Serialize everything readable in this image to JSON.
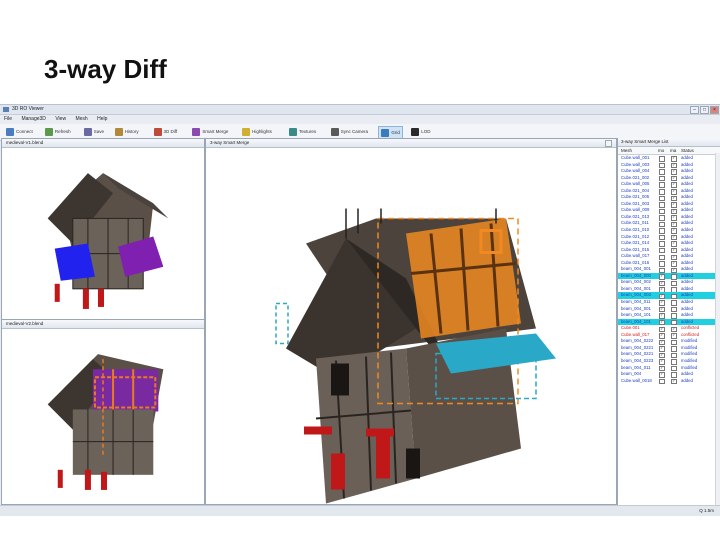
{
  "slide": {
    "title": "3-way Diff"
  },
  "window": {
    "title": "3D RO Viewer"
  },
  "menu": [
    "File",
    "Manage3D",
    "View",
    "Mesh",
    "Help"
  ],
  "toolbar": {
    "buttons": [
      {
        "label": "Connect",
        "icon": "plug-icon",
        "color": "#4a7cc0"
      },
      {
        "label": "Refresh",
        "icon": "refresh-icon",
        "color": "#5a9a4a"
      },
      {
        "label": "Save",
        "icon": "save-icon",
        "color": "#6a6aa0"
      },
      {
        "label": "History",
        "icon": "clock-icon",
        "color": "#b08a3a"
      },
      {
        "label": "3D Diff",
        "icon": "diff-icon",
        "color": "#c04a3a"
      },
      {
        "label": "Smart Merge",
        "icon": "merge-icon",
        "color": "#8a4ab0"
      },
      {
        "label": "Highlights",
        "icon": "highlight-icon",
        "color": "#d0b030"
      },
      {
        "label": "Textures",
        "icon": "texture-icon",
        "color": "#3a8a8a"
      },
      {
        "label": "Sync Camera",
        "icon": "camera-icon",
        "color": "#5a5a5a"
      },
      {
        "label": "Grid",
        "icon": "grid-icon",
        "color": "#3a7ac0"
      },
      {
        "label": "LOD",
        "icon": "lod-icon",
        "color": "#2a2a2a"
      }
    ],
    "active_index": 9
  },
  "panes": {
    "left_top": {
      "title": "medieval-V1.blend"
    },
    "left_bottom": {
      "title": "medieval-V2.blend"
    },
    "merge": {
      "title": "3-way Smart Merge"
    }
  },
  "list": {
    "title": "3-way Smart Merge List",
    "headers": {
      "mesh": "Mesh",
      "mine": "mo",
      "master": "ma",
      "status": "Status"
    },
    "rows": [
      {
        "mesh": "Cube.wall_001",
        "status": "added",
        "color": "#2040c0",
        "hl": false,
        "mine": false,
        "master": true
      },
      {
        "mesh": "Cube.wall_003",
        "status": "added",
        "color": "#2040c0",
        "hl": false,
        "mine": false,
        "master": true
      },
      {
        "mesh": "Cube.wall_004",
        "status": "added",
        "color": "#2040c0",
        "hl": false,
        "mine": false,
        "master": true
      },
      {
        "mesh": "Cube.021_002",
        "status": "added",
        "color": "#2040c0",
        "hl": false,
        "mine": false,
        "master": true
      },
      {
        "mesh": "Cube.wall_005",
        "status": "added",
        "color": "#2040c0",
        "hl": false,
        "mine": false,
        "master": true
      },
      {
        "mesh": "Cube.021_004",
        "status": "added",
        "color": "#2040c0",
        "hl": false,
        "mine": false,
        "master": true
      },
      {
        "mesh": "Cube.021_005",
        "status": "added",
        "color": "#2040c0",
        "hl": false,
        "mine": false,
        "master": true
      },
      {
        "mesh": "Cube.021_003",
        "status": "added",
        "color": "#2040c0",
        "hl": false,
        "mine": false,
        "master": true
      },
      {
        "mesh": "Cube.wall_009",
        "status": "added",
        "color": "#2040c0",
        "hl": false,
        "mine": false,
        "master": true
      },
      {
        "mesh": "Cube.021_013",
        "status": "added",
        "color": "#2040c0",
        "hl": false,
        "mine": false,
        "master": true
      },
      {
        "mesh": "Cube.021_011",
        "status": "added",
        "color": "#2040c0",
        "hl": false,
        "mine": false,
        "master": true
      },
      {
        "mesh": "Cube.021_010",
        "status": "added",
        "color": "#2040c0",
        "hl": false,
        "mine": false,
        "master": true
      },
      {
        "mesh": "Cube.021_012",
        "status": "added",
        "color": "#2040c0",
        "hl": false,
        "mine": false,
        "master": true
      },
      {
        "mesh": "Cube.021_014",
        "status": "added",
        "color": "#2040c0",
        "hl": false,
        "mine": false,
        "master": true
      },
      {
        "mesh": "Cube.021_015",
        "status": "added",
        "color": "#2040c0",
        "hl": false,
        "mine": false,
        "master": true
      },
      {
        "mesh": "Cube.wall_017",
        "status": "added",
        "color": "#2040c0",
        "hl": false,
        "mine": false,
        "master": true
      },
      {
        "mesh": "Cube.021_016",
        "status": "added",
        "color": "#2040c0",
        "hl": false,
        "mine": false,
        "master": true
      },
      {
        "mesh": "beam_004_001",
        "status": "added",
        "color": "#2040c0",
        "hl": false,
        "mine": false,
        "master": true
      },
      {
        "mesh": "beam_004_000",
        "status": "added",
        "color": "#2040c0",
        "hl": true,
        "mine": true,
        "master": false
      },
      {
        "mesh": "beam_004_002",
        "status": "added",
        "color": "#2040c0",
        "hl": false,
        "mine": true,
        "master": false
      },
      {
        "mesh": "beam_004_001",
        "status": "added",
        "color": "#2040c0",
        "hl": false,
        "mine": true,
        "master": false
      },
      {
        "mesh": "beam_004_003",
        "status": "added",
        "color": "#2040c0",
        "hl": true,
        "mine": true,
        "master": false
      },
      {
        "mesh": "beam_004_011",
        "status": "added",
        "color": "#2040c0",
        "hl": false,
        "mine": true,
        "master": false
      },
      {
        "mesh": "beam_004_001",
        "status": "added",
        "color": "#2040c0",
        "hl": false,
        "mine": true,
        "master": false
      },
      {
        "mesh": "beam_004_101",
        "status": "added",
        "color": "#2040c0",
        "hl": false,
        "mine": true,
        "master": false
      },
      {
        "mesh": "beam_004_101",
        "status": "added",
        "color": "#2040c0",
        "hl": true,
        "mine": true,
        "master": false
      },
      {
        "mesh": "Cube.001",
        "status": "conflicted",
        "color": "#d02020",
        "hl": false,
        "mine": true,
        "master": true
      },
      {
        "mesh": "Cube.wall_017",
        "status": "conflicted",
        "color": "#d02020",
        "hl": false,
        "mine": true,
        "master": true
      },
      {
        "mesh": "beam_004_0222",
        "status": "modified",
        "color": "#2040c0",
        "hl": false,
        "mine": true,
        "master": false
      },
      {
        "mesh": "beam_004_0221",
        "status": "modified",
        "color": "#2040c0",
        "hl": false,
        "mine": true,
        "master": false
      },
      {
        "mesh": "beam_004_0221",
        "status": "modified",
        "color": "#2040c0",
        "hl": false,
        "mine": true,
        "master": false
      },
      {
        "mesh": "beam_004_0223",
        "status": "modified",
        "color": "#2040c0",
        "hl": false,
        "mine": true,
        "master": false
      },
      {
        "mesh": "beam_004_011",
        "status": "modified",
        "color": "#2040c0",
        "hl": false,
        "mine": true,
        "master": false
      },
      {
        "mesh": "beam_004",
        "status": "added",
        "color": "#2040c0",
        "hl": false,
        "mine": true,
        "master": false
      },
      {
        "mesh": "Cube.wall_0018",
        "status": "added",
        "color": "#2040c0",
        "hl": false,
        "mine": false,
        "master": true
      }
    ]
  },
  "status_bar": {
    "text": "Q 1.5m"
  }
}
